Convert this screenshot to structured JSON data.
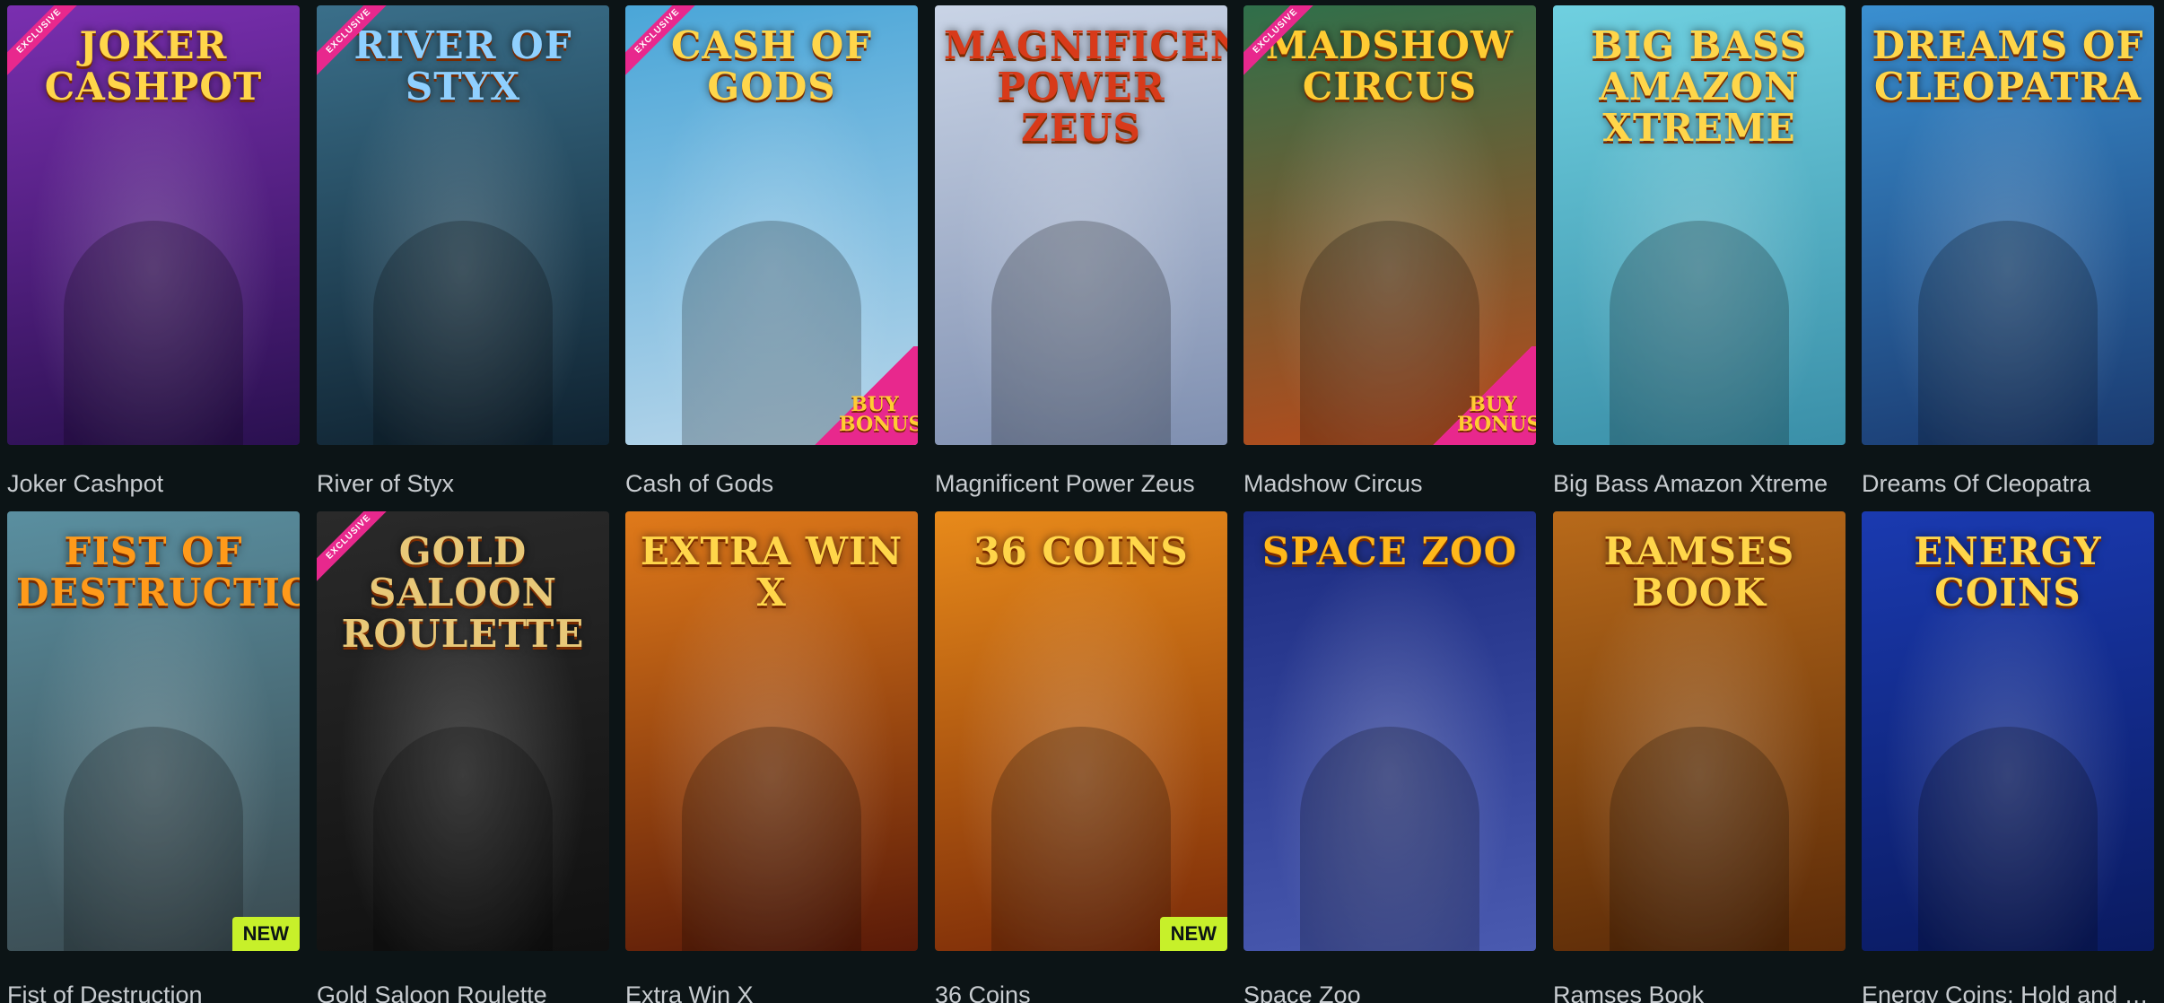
{
  "games": [
    {
      "id": "joker-cashpot",
      "title": "Joker Cashpot",
      "logo": "JOKER CASHPOT",
      "exclusive": true,
      "buy_bonus": false,
      "new": false,
      "bg1": "#7a2fb0",
      "bg2": "#2a1050",
      "logo_color": "#ffd64a"
    },
    {
      "id": "river-of-styx",
      "title": "River of Styx",
      "logo": "RIVER OF STYX",
      "exclusive": true,
      "buy_bonus": false,
      "new": false,
      "bg1": "#3a6f8a",
      "bg2": "#0f2230",
      "logo_color": "#8fd0ff"
    },
    {
      "id": "cash-of-gods",
      "title": "Cash of Gods",
      "logo": "CASH OF GODS",
      "exclusive": true,
      "buy_bonus": true,
      "new": false,
      "bg1": "#4aa6d8",
      "bg2": "#b8d6ea",
      "logo_color": "#ffd64a"
    },
    {
      "id": "magnificent-power-zeus",
      "title": "Magnificent Power Zeus",
      "logo": "MAGNIFICENT POWER ZEUS",
      "exclusive": false,
      "buy_bonus": false,
      "new": false,
      "bg1": "#c9d4e6",
      "bg2": "#7f8fb0",
      "logo_color": "#d83a1a"
    },
    {
      "id": "madshow-circus",
      "title": "Madshow Circus",
      "logo": "MADSHOW CIRCUS",
      "exclusive": true,
      "buy_bonus": true,
      "new": false,
      "bg1": "#2f6f4a",
      "bg2": "#b84a1a",
      "logo_color": "#ffcc33"
    },
    {
      "id": "big-bass-amazon-xtreme",
      "title": "Big Bass Amazon Xtreme",
      "logo": "BIG BASS AMAZON XTREME",
      "exclusive": false,
      "buy_bonus": false,
      "new": false,
      "bg1": "#6fd0e0",
      "bg2": "#3a8fa8",
      "logo_color": "#ffd64a"
    },
    {
      "id": "dreams-of-cleopatra",
      "title": "Dreams Of Cleopatra",
      "logo": "DREAMS OF CLEOPATRA",
      "exclusive": false,
      "buy_bonus": false,
      "new": false,
      "bg1": "#3a8fd0",
      "bg2": "#1a3a70",
      "logo_color": "#ffd64a"
    },
    {
      "id": "fist-of-destruction",
      "title": "Fist of Destruction",
      "logo": "FIST OF DESTRUCTION",
      "exclusive": false,
      "buy_bonus": false,
      "new": true,
      "bg1": "#5a8fa0",
      "bg2": "#3a4a50",
      "logo_color": "#ff9a1a"
    },
    {
      "id": "gold-saloon-roulette",
      "title": "Gold Saloon Roulette",
      "logo": "GOLD SALOON ROULETTE",
      "exclusive": true,
      "buy_bonus": false,
      "new": false,
      "bg1": "#2a2a2a",
      "bg2": "#101010",
      "logo_color": "#e8c878"
    },
    {
      "id": "extra-win-x",
      "title": "Extra Win X",
      "logo": "EXTRA WIN X",
      "exclusive": false,
      "buy_bonus": false,
      "new": false,
      "bg1": "#e07a1a",
      "bg2": "#5a1a08",
      "logo_color": "#ffd64a"
    },
    {
      "id": "36-coins",
      "title": "36 Coins",
      "logo": "36 COINS",
      "exclusive": false,
      "buy_bonus": false,
      "new": true,
      "bg1": "#e88a1a",
      "bg2": "#7a2a08",
      "logo_color": "#ffd64a"
    },
    {
      "id": "space-zoo",
      "title": "Space Zoo",
      "logo": "SPACE ZOO",
      "exclusive": false,
      "buy_bonus": false,
      "new": false,
      "bg1": "#1a2a80",
      "bg2": "#4a5ab0",
      "logo_color": "#ffb81a"
    },
    {
      "id": "ramses-book",
      "title": "Ramses Book",
      "logo": "RAMSES BOOK",
      "exclusive": false,
      "buy_bonus": false,
      "new": false,
      "bg1": "#b86a1a",
      "bg2": "#5a2a08",
      "logo_color": "#ffd64a"
    },
    {
      "id": "energy-coins",
      "title": "Energy Coins: Hold and W...",
      "logo": "ENERGY COINS",
      "exclusive": false,
      "buy_bonus": false,
      "new": false,
      "bg1": "#1a3ab0",
      "bg2": "#0a1a60",
      "logo_color": "#ffd64a"
    }
  ],
  "labels": {
    "exclusive": "EXCLUSIVE",
    "buy_bonus": "BUY BONUS",
    "new": "NEW"
  }
}
